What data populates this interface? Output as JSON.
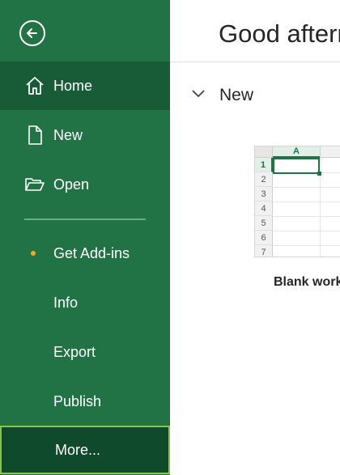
{
  "colors": {
    "sidebar": "#217346",
    "active": "#185c37",
    "selected": "#0f4a2c",
    "accent_dot": "#f5a623"
  },
  "sidebar": {
    "items": [
      {
        "label": "Home",
        "icon": "home-icon"
      },
      {
        "label": "New",
        "icon": "new-document-icon"
      },
      {
        "label": "Open",
        "icon": "open-folder-icon"
      },
      {
        "label": "Get Add-ins"
      },
      {
        "label": "Info"
      },
      {
        "label": "Export"
      },
      {
        "label": "Publish"
      },
      {
        "label": "More..."
      }
    ]
  },
  "main": {
    "greeting": "Good afternoon",
    "section_title": "New",
    "template": {
      "caption": "Blank workbook",
      "column_label": "A",
      "row_labels": [
        "1",
        "2",
        "3",
        "4",
        "5",
        "6",
        "7"
      ]
    }
  }
}
